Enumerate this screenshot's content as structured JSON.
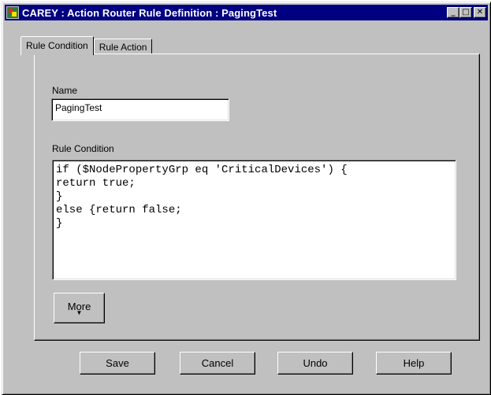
{
  "window": {
    "title": "CAREY : Action Router Rule Definition  : PagingTest",
    "minimize_glyph": "_",
    "maximize_glyph": "□",
    "close_glyph": "✕"
  },
  "tabs": [
    {
      "label": "Rule Condition",
      "active": true
    },
    {
      "label": "Rule Action",
      "active": false
    }
  ],
  "form": {
    "name_label": "Name",
    "name_value": "PagingTest",
    "condition_label": "Rule Condition",
    "condition_text": "if ($NodePropertyGrp eq 'CriticalDevices') {\nreturn true;\n}\nelse {return false;\n}",
    "more_label": "More",
    "more_arrow": "▼"
  },
  "buttons": {
    "save": "Save",
    "cancel": "Cancel",
    "undo": "Undo",
    "help": "Help"
  },
  "icons": {
    "app": "app-icon"
  }
}
